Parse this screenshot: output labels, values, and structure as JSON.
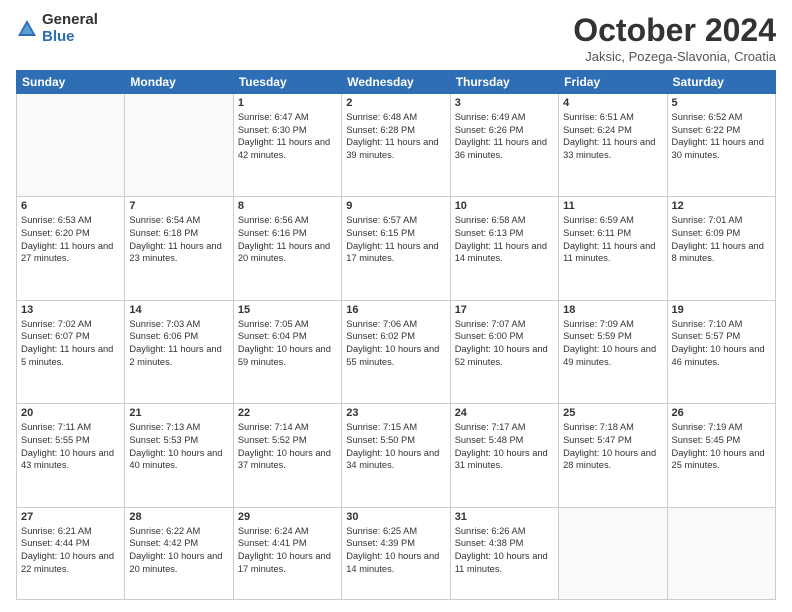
{
  "header": {
    "logo_general": "General",
    "logo_blue": "Blue",
    "title": "October 2024",
    "location": "Jaksic, Pozega-Slavonia, Croatia"
  },
  "days_of_week": [
    "Sunday",
    "Monday",
    "Tuesday",
    "Wednesday",
    "Thursday",
    "Friday",
    "Saturday"
  ],
  "weeks": [
    [
      {
        "day": "",
        "sunrise": "",
        "sunset": "",
        "daylight": ""
      },
      {
        "day": "",
        "sunrise": "",
        "sunset": "",
        "daylight": ""
      },
      {
        "day": "1",
        "sunrise": "Sunrise: 6:47 AM",
        "sunset": "Sunset: 6:30 PM",
        "daylight": "Daylight: 11 hours and 42 minutes."
      },
      {
        "day": "2",
        "sunrise": "Sunrise: 6:48 AM",
        "sunset": "Sunset: 6:28 PM",
        "daylight": "Daylight: 11 hours and 39 minutes."
      },
      {
        "day": "3",
        "sunrise": "Sunrise: 6:49 AM",
        "sunset": "Sunset: 6:26 PM",
        "daylight": "Daylight: 11 hours and 36 minutes."
      },
      {
        "day": "4",
        "sunrise": "Sunrise: 6:51 AM",
        "sunset": "Sunset: 6:24 PM",
        "daylight": "Daylight: 11 hours and 33 minutes."
      },
      {
        "day": "5",
        "sunrise": "Sunrise: 6:52 AM",
        "sunset": "Sunset: 6:22 PM",
        "daylight": "Daylight: 11 hours and 30 minutes."
      }
    ],
    [
      {
        "day": "6",
        "sunrise": "Sunrise: 6:53 AM",
        "sunset": "Sunset: 6:20 PM",
        "daylight": "Daylight: 11 hours and 27 minutes."
      },
      {
        "day": "7",
        "sunrise": "Sunrise: 6:54 AM",
        "sunset": "Sunset: 6:18 PM",
        "daylight": "Daylight: 11 hours and 23 minutes."
      },
      {
        "day": "8",
        "sunrise": "Sunrise: 6:56 AM",
        "sunset": "Sunset: 6:16 PM",
        "daylight": "Daylight: 11 hours and 20 minutes."
      },
      {
        "day": "9",
        "sunrise": "Sunrise: 6:57 AM",
        "sunset": "Sunset: 6:15 PM",
        "daylight": "Daylight: 11 hours and 17 minutes."
      },
      {
        "day": "10",
        "sunrise": "Sunrise: 6:58 AM",
        "sunset": "Sunset: 6:13 PM",
        "daylight": "Daylight: 11 hours and 14 minutes."
      },
      {
        "day": "11",
        "sunrise": "Sunrise: 6:59 AM",
        "sunset": "Sunset: 6:11 PM",
        "daylight": "Daylight: 11 hours and 11 minutes."
      },
      {
        "day": "12",
        "sunrise": "Sunrise: 7:01 AM",
        "sunset": "Sunset: 6:09 PM",
        "daylight": "Daylight: 11 hours and 8 minutes."
      }
    ],
    [
      {
        "day": "13",
        "sunrise": "Sunrise: 7:02 AM",
        "sunset": "Sunset: 6:07 PM",
        "daylight": "Daylight: 11 hours and 5 minutes."
      },
      {
        "day": "14",
        "sunrise": "Sunrise: 7:03 AM",
        "sunset": "Sunset: 6:06 PM",
        "daylight": "Daylight: 11 hours and 2 minutes."
      },
      {
        "day": "15",
        "sunrise": "Sunrise: 7:05 AM",
        "sunset": "Sunset: 6:04 PM",
        "daylight": "Daylight: 10 hours and 59 minutes."
      },
      {
        "day": "16",
        "sunrise": "Sunrise: 7:06 AM",
        "sunset": "Sunset: 6:02 PM",
        "daylight": "Daylight: 10 hours and 55 minutes."
      },
      {
        "day": "17",
        "sunrise": "Sunrise: 7:07 AM",
        "sunset": "Sunset: 6:00 PM",
        "daylight": "Daylight: 10 hours and 52 minutes."
      },
      {
        "day": "18",
        "sunrise": "Sunrise: 7:09 AM",
        "sunset": "Sunset: 5:59 PM",
        "daylight": "Daylight: 10 hours and 49 minutes."
      },
      {
        "day": "19",
        "sunrise": "Sunrise: 7:10 AM",
        "sunset": "Sunset: 5:57 PM",
        "daylight": "Daylight: 10 hours and 46 minutes."
      }
    ],
    [
      {
        "day": "20",
        "sunrise": "Sunrise: 7:11 AM",
        "sunset": "Sunset: 5:55 PM",
        "daylight": "Daylight: 10 hours and 43 minutes."
      },
      {
        "day": "21",
        "sunrise": "Sunrise: 7:13 AM",
        "sunset": "Sunset: 5:53 PM",
        "daylight": "Daylight: 10 hours and 40 minutes."
      },
      {
        "day": "22",
        "sunrise": "Sunrise: 7:14 AM",
        "sunset": "Sunset: 5:52 PM",
        "daylight": "Daylight: 10 hours and 37 minutes."
      },
      {
        "day": "23",
        "sunrise": "Sunrise: 7:15 AM",
        "sunset": "Sunset: 5:50 PM",
        "daylight": "Daylight: 10 hours and 34 minutes."
      },
      {
        "day": "24",
        "sunrise": "Sunrise: 7:17 AM",
        "sunset": "Sunset: 5:48 PM",
        "daylight": "Daylight: 10 hours and 31 minutes."
      },
      {
        "day": "25",
        "sunrise": "Sunrise: 7:18 AM",
        "sunset": "Sunset: 5:47 PM",
        "daylight": "Daylight: 10 hours and 28 minutes."
      },
      {
        "day": "26",
        "sunrise": "Sunrise: 7:19 AM",
        "sunset": "Sunset: 5:45 PM",
        "daylight": "Daylight: 10 hours and 25 minutes."
      }
    ],
    [
      {
        "day": "27",
        "sunrise": "Sunrise: 6:21 AM",
        "sunset": "Sunset: 4:44 PM",
        "daylight": "Daylight: 10 hours and 22 minutes."
      },
      {
        "day": "28",
        "sunrise": "Sunrise: 6:22 AM",
        "sunset": "Sunset: 4:42 PM",
        "daylight": "Daylight: 10 hours and 20 minutes."
      },
      {
        "day": "29",
        "sunrise": "Sunrise: 6:24 AM",
        "sunset": "Sunset: 4:41 PM",
        "daylight": "Daylight: 10 hours and 17 minutes."
      },
      {
        "day": "30",
        "sunrise": "Sunrise: 6:25 AM",
        "sunset": "Sunset: 4:39 PM",
        "daylight": "Daylight: 10 hours and 14 minutes."
      },
      {
        "day": "31",
        "sunrise": "Sunrise: 6:26 AM",
        "sunset": "Sunset: 4:38 PM",
        "daylight": "Daylight: 10 hours and 11 minutes."
      },
      {
        "day": "",
        "sunrise": "",
        "sunset": "",
        "daylight": ""
      },
      {
        "day": "",
        "sunrise": "",
        "sunset": "",
        "daylight": ""
      }
    ]
  ]
}
